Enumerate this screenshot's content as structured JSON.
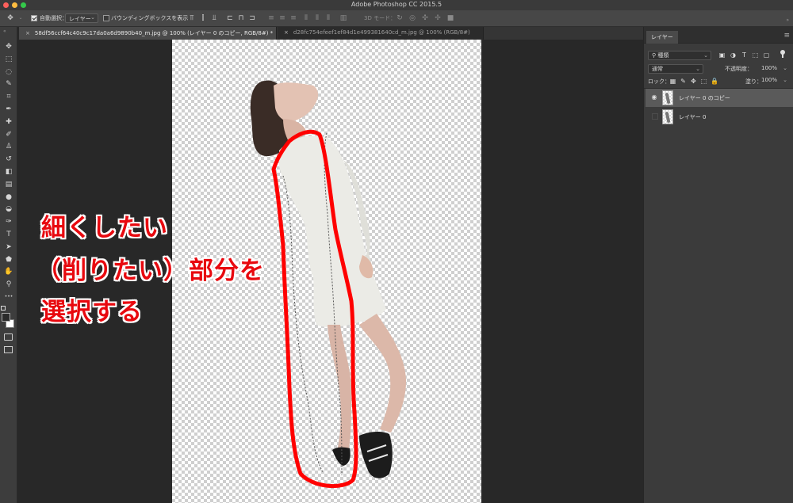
{
  "window": {
    "title": "Adobe Photoshop CC 2015.5"
  },
  "traffic_lights": {
    "close_color": "#fc605c",
    "minimize_color": "#fdbc40",
    "zoom_color": "#34c84a"
  },
  "options_bar": {
    "auto_select_label": "自動選択：",
    "auto_select_checked": true,
    "auto_select_target": "レイヤー",
    "bounding_box_label": "バウンディングボックスを表示",
    "bounding_box_checked": false,
    "mode_3d_label": "3D モード："
  },
  "doc_tabs": [
    {
      "label": "58df56ccf64c40c9c17da0a6d9890b40_m.jpg @ 100% (レイヤー 0 のコピー, RGB/8#) *",
      "active": true
    },
    {
      "label": "d28fc754efeef1ef84d1e499381640cd_m.jpg @ 100% (RGB/8#)",
      "active": false
    }
  ],
  "toolbar": {
    "tools": [
      {
        "name": "move-tool-icon",
        "glyph": "✥"
      },
      {
        "name": "marquee-tool-icon",
        "glyph": "⬚"
      },
      {
        "name": "lasso-tool-icon",
        "glyph": "◌"
      },
      {
        "name": "quick-select-tool-icon",
        "glyph": "✎"
      },
      {
        "name": "crop-tool-icon",
        "glyph": "⌗"
      },
      {
        "name": "eyedropper-tool-icon",
        "glyph": "✒"
      },
      {
        "name": "healing-brush-tool-icon",
        "glyph": "✚"
      },
      {
        "name": "brush-tool-icon",
        "glyph": "✐"
      },
      {
        "name": "clone-stamp-tool-icon",
        "glyph": "♙"
      },
      {
        "name": "history-brush-tool-icon",
        "glyph": "↺"
      },
      {
        "name": "eraser-tool-icon",
        "glyph": "◧"
      },
      {
        "name": "gradient-tool-icon",
        "glyph": "▤"
      },
      {
        "name": "blur-tool-icon",
        "glyph": "●"
      },
      {
        "name": "dodge-tool-icon",
        "glyph": "◒"
      },
      {
        "name": "pen-tool-icon",
        "glyph": "✑"
      },
      {
        "name": "type-tool-icon",
        "glyph": "T"
      },
      {
        "name": "path-select-tool-icon",
        "glyph": "➤"
      },
      {
        "name": "shape-tool-icon",
        "glyph": "⬟"
      },
      {
        "name": "hand-tool-icon",
        "glyph": "✋"
      },
      {
        "name": "zoom-tool-icon",
        "glyph": "⚲"
      },
      {
        "name": "more-tools-icon",
        "glyph": "•••"
      }
    ],
    "foreground_color": "#2b2b2b",
    "background_color": "#ffffff"
  },
  "annotation": {
    "line1": "細くしたい",
    "line2": "（削りたい）部分を",
    "line3": "選択する",
    "color": "#e8090f",
    "stroke_color": "#ff0000"
  },
  "layers_panel": {
    "tab_label": "レイヤー",
    "filter_kind": "種類",
    "blend_mode": "通常",
    "opacity_label": "不透明度：",
    "opacity_value": "100%",
    "lock_label": "ロック：",
    "fill_label": "塗り：",
    "fill_value": "100%",
    "layers": [
      {
        "name": "レイヤー 0 のコピー",
        "visible": true,
        "selected": true
      },
      {
        "name": "レイヤー 0",
        "visible": false,
        "selected": false
      }
    ]
  }
}
